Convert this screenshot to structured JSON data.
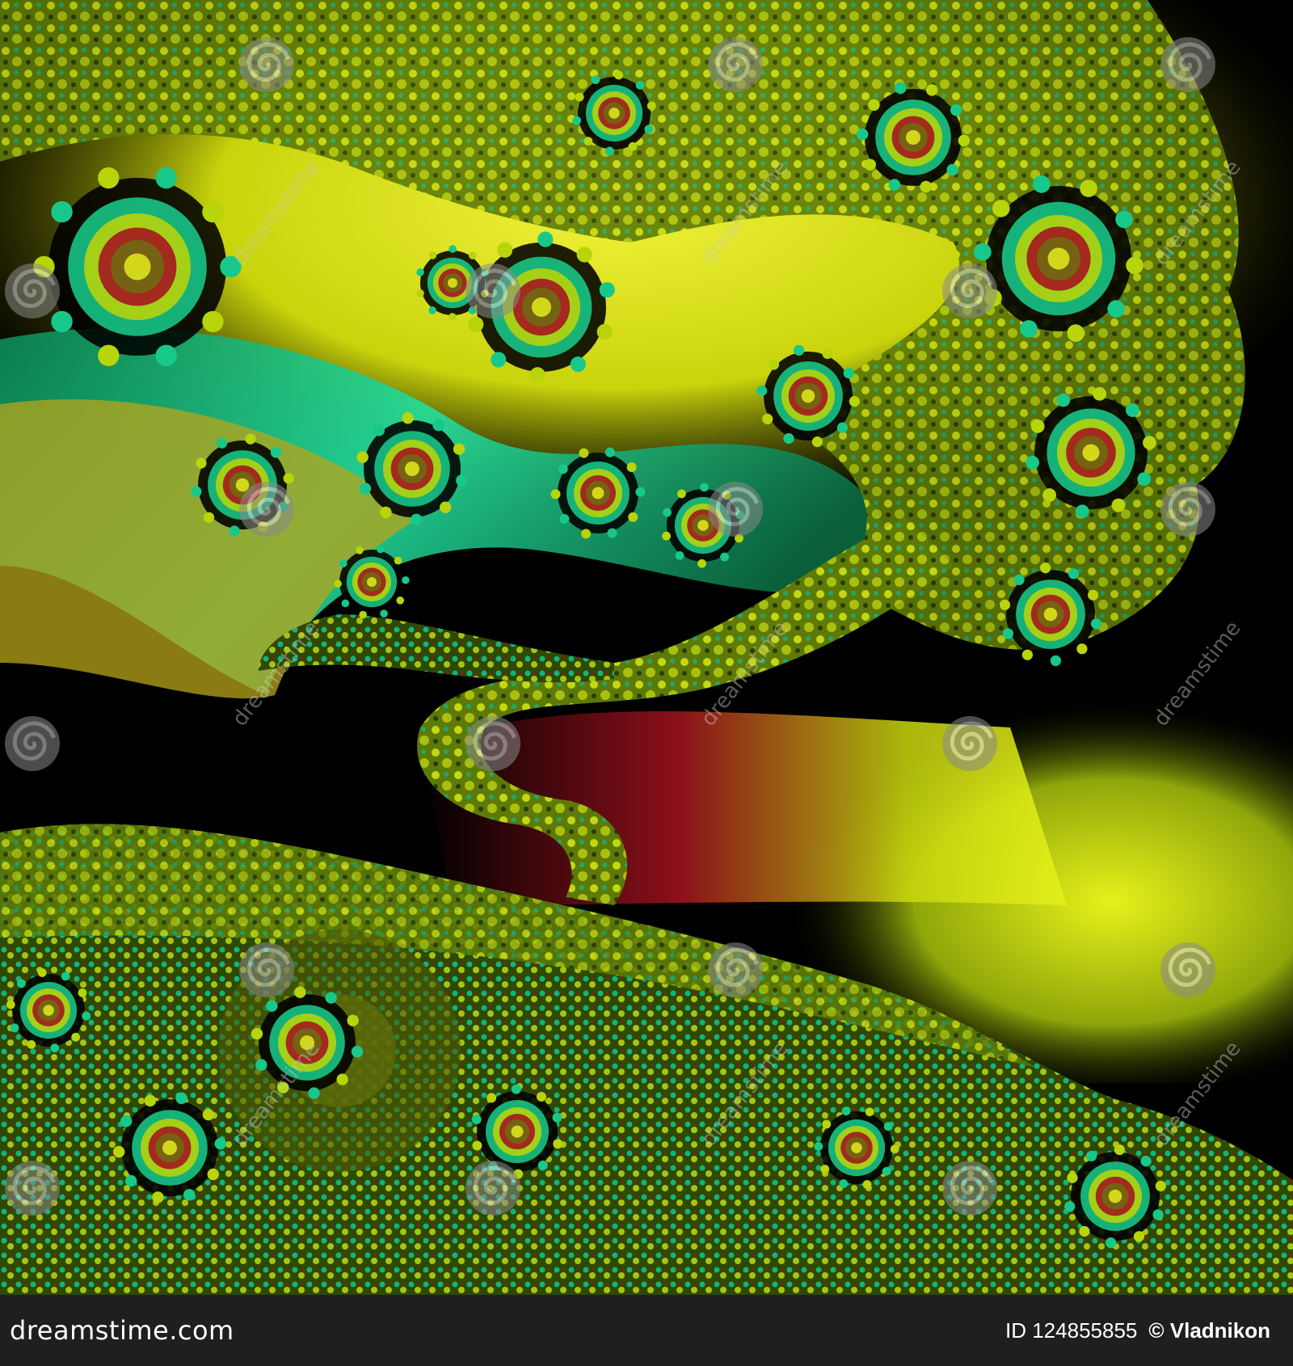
{
  "image": {
    "subject": "fractal-spiral-artwork",
    "palette": {
      "yellow": "#dfe81a",
      "lime": "#b8d40a",
      "teal": "#18c88a",
      "olive": "#6f6a12",
      "red": "#a3121e",
      "black": "#000000"
    }
  },
  "watermark": {
    "text": "dreamstime",
    "icon": "spiral-logo-icon"
  },
  "footer": {
    "logo": "dreamstime.com",
    "id_text": "ID 124855855",
    "author_text": "© Vladnikon",
    "background": "#1f1f1f"
  }
}
